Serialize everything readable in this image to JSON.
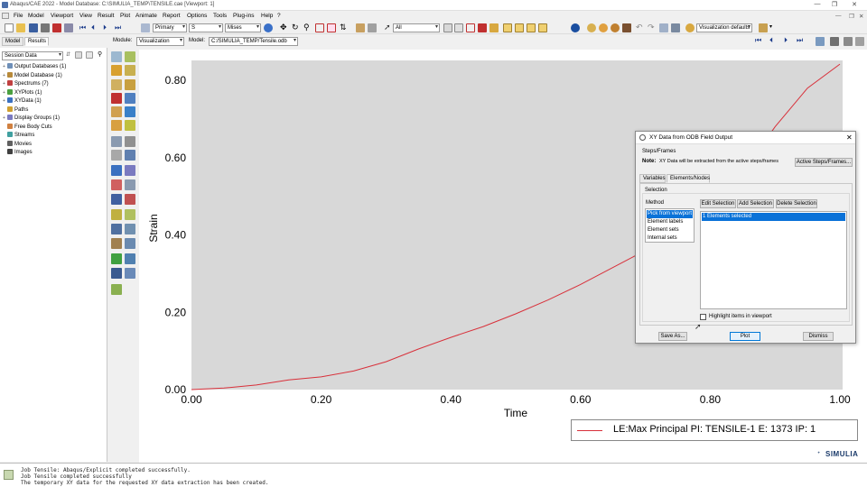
{
  "window": {
    "title": "Abaqus/CAE 2022 - Model Database: C:\\SIMULIA_TEMP\\TENSILE.cae [Viewport: 1]",
    "controls": [
      "—",
      "❐",
      "✕"
    ],
    "sub_controls": [
      "—",
      "❐",
      "✕"
    ]
  },
  "menu": [
    "File",
    "Model",
    "Viewport",
    "View",
    "Result",
    "Plot",
    "Animate",
    "Report",
    "Options",
    "Tools",
    "Plug-ins",
    "Help",
    "?"
  ],
  "toolbar": {
    "primary_value": "Primary",
    "field_value": "S",
    "invariant_value": "Mises",
    "selection_filter": "All",
    "visualization_defaults": "Visualization defaults"
  },
  "context": {
    "module_label": "Module:",
    "module_value": "Visualization",
    "model_label": "Model:",
    "model_value": "C:/SIMULIA_TEMP/Tensile.odb"
  },
  "leftpanel": {
    "tabs": [
      "Model",
      "Results"
    ],
    "active_tab": "Results",
    "session_select": "Session Data",
    "tree": [
      {
        "label": "Output Databases (1)",
        "expand": "+",
        "color": "#6e8fb8"
      },
      {
        "label": "Model Database (1)",
        "expand": "+",
        "color": "#b88a3a"
      },
      {
        "label": "Spectrums (7)",
        "expand": "+",
        "color": "#c04040"
      },
      {
        "label": "XYPlots (1)",
        "expand": "+",
        "color": "#4aa040"
      },
      {
        "label": "XYData (1)",
        "expand": "+",
        "color": "#3a70c0"
      },
      {
        "label": "Paths",
        "expand": "",
        "color": "#d0a030"
      },
      {
        "label": "Display Groups (1)",
        "expand": "+",
        "color": "#7a7ac0"
      },
      {
        "label": "Free Body Cuts",
        "expand": "",
        "color": "#d08040"
      },
      {
        "label": "Streams",
        "expand": "",
        "color": "#40a0a0"
      },
      {
        "label": "Movies",
        "expand": "",
        "color": "#606060"
      },
      {
        "label": "Images",
        "expand": "",
        "color": "#404040"
      }
    ]
  },
  "chart_data": {
    "type": "line",
    "title": "",
    "xlabel": "Time",
    "ylabel": "Strain",
    "xlim": [
      0,
      1.0
    ],
    "ylim": [
      0,
      0.84
    ],
    "xticks": [
      "0.00",
      "0.20",
      "0.40",
      "0.60",
      "0.80",
      "1.00"
    ],
    "yticks": [
      "0.00",
      "0.20",
      "0.40",
      "0.60",
      "0.80"
    ],
    "grid": false,
    "legend_position": "bottom-right",
    "series": [
      {
        "name": "LE:Max Principal PI: TENSILE-1 E: 1373 IP: 1",
        "color": "#d8303a",
        "x": [
          0.0,
          0.05,
          0.1,
          0.15,
          0.2,
          0.25,
          0.3,
          0.35,
          0.4,
          0.45,
          0.5,
          0.55,
          0.6,
          0.65,
          0.7,
          0.75,
          0.8,
          0.85,
          0.9,
          0.95,
          1.0
        ],
        "y": [
          0.0,
          0.004,
          0.012,
          0.025,
          0.033,
          0.048,
          0.072,
          0.105,
          0.135,
          0.163,
          0.196,
          0.232,
          0.272,
          0.316,
          0.36,
          0.405,
          0.48,
          0.56,
          0.68,
          0.78,
          0.842
        ]
      }
    ]
  },
  "dialog": {
    "title": "XY Data from ODB Field Output",
    "close": "✕",
    "steps_label": "Steps/Frames",
    "note_label": "Note:",
    "note_text": "XY Data will be extracted from the active steps/frames",
    "active_steps_button": "Active Steps/Frames...",
    "tabs": [
      "Variables",
      "Elements/Nodes"
    ],
    "active_tab": "Elements/Nodes",
    "selection_label": "Selection",
    "method_label": "Method",
    "methods": [
      "Pick from viewport",
      "Element labels",
      "Element sets",
      "Internal sets"
    ],
    "selected_method": "Pick from viewport",
    "edit_selection": "Edit Selection",
    "add_selection": "Add Selection",
    "delete_selection": "Delete Selection",
    "selected_items": [
      "1 Elements selected"
    ],
    "highlight_label": "Highlight items in viewport",
    "save_as": "Save As...",
    "plot": "Plot",
    "dismiss": "Dismiss"
  },
  "viewport_brand": "SIMULIA",
  "messages": [
    "Job Tensile: Abaqus/Explicit completed successfully.",
    "Job Tensile completed successfully",
    "The temporary XY data for the requested XY data extraction has been created."
  ]
}
